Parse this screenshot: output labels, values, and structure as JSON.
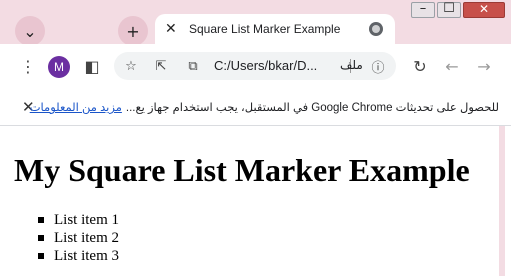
{
  "window": {
    "minimize_glyph": "–",
    "maximize_glyph": "☐",
    "close_glyph": "✕"
  },
  "tabs": {
    "dropdown_glyph": "⌄",
    "new_tab_glyph": "+",
    "active_tab": {
      "close_glyph": "✕",
      "title": "Square List Marker Example",
      "favicon": "globe-icon"
    }
  },
  "toolbar": {
    "menu_glyph": "⋮",
    "profile_initial": "M",
    "profile_color": "#6b2fa1",
    "sidebar_glyph": "◧",
    "reload_glyph": "↻",
    "back_glyph": "←",
    "forward_glyph": "→"
  },
  "omnibox": {
    "bookmark_glyph": "☆",
    "share_glyph": "⇱",
    "install_glyph": "⧉",
    "url": "C:/Users/bkar/D...",
    "info_glyph": "ⓘ",
    "file_label": "ملف"
  },
  "infobar": {
    "close_glyph": "✕",
    "message": "للحصول على تحديثات Google Chrome في المستقبل، يجب استخدام جهاز يع...",
    "link": "مزيد من المعلومات",
    "link_color": "#1a55c9"
  },
  "page": {
    "heading": "My Square List Marker Example",
    "items": [
      "List item 1",
      "List item 2",
      "List item 3"
    ]
  },
  "colors": {
    "chrome_frame": "#f3dce3",
    "close_button": "#c7504a"
  }
}
